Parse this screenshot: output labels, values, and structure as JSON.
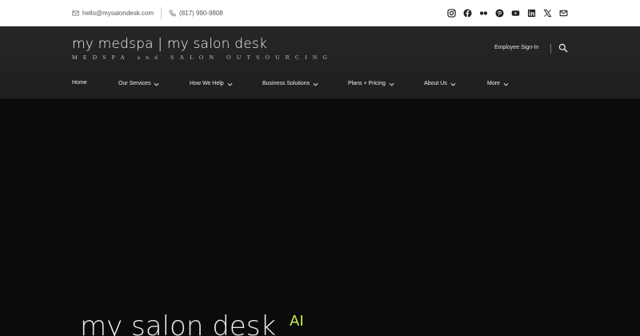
{
  "topbar": {
    "email": "hello@mysalondesk.com",
    "phone": "(817) 990-9808",
    "social_icons": [
      "instagram-icon",
      "facebook-icon",
      "flickr-icon",
      "pinterest-icon",
      "youtube-icon",
      "linkedin-icon",
      "x-icon",
      "mail-icon"
    ]
  },
  "header": {
    "logo_main": "my medspa | my salon desk",
    "logo_sub": "MEDSPA and SALON OUTSOURCING",
    "employee_signin": "Employee Sign-In"
  },
  "nav": {
    "items": [
      {
        "label": "Home",
        "dropdown": false
      },
      {
        "label": "Our Services",
        "dropdown": true
      },
      {
        "label": "How We Help",
        "dropdown": true
      },
      {
        "label": "Business Solutions",
        "dropdown": true
      },
      {
        "label": "Plans + Pricing",
        "dropdown": true
      },
      {
        "label": "About Us",
        "dropdown": true
      },
      {
        "label": "More",
        "dropdown": true
      }
    ]
  },
  "hero": {
    "title": "my salon desk",
    "title_sup": "AI"
  },
  "colors": {
    "accent": "#c6ea4a",
    "header_bg": "#232323",
    "hero_bg": "#0b0b0b"
  }
}
